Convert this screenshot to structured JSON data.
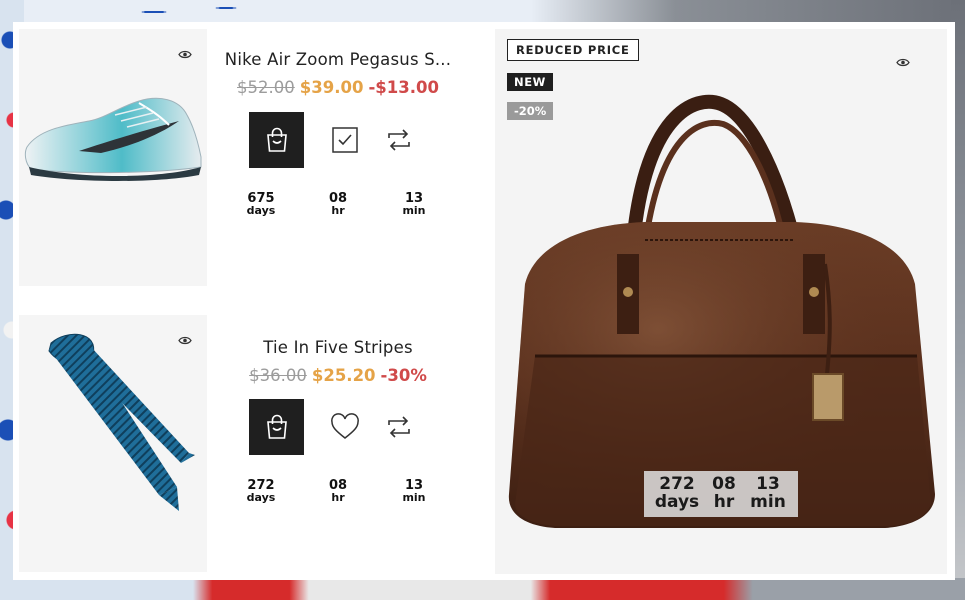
{
  "products": [
    {
      "title": "Nike Air Zoom Pegasus S...",
      "old_price": "$52.00",
      "new_price": "$39.00",
      "discount": "-$13.00",
      "actions": [
        "shopping-bag-icon",
        "checkbox-checked-icon",
        "compare-icon"
      ],
      "countdown": {
        "days": "675",
        "days_label": "days",
        "hr": "08",
        "hr_label": "hr",
        "min": "13",
        "min_label": "min"
      }
    },
    {
      "title": "Tie In Five Stripes",
      "old_price": "$36.00",
      "new_price": "$25.20",
      "discount": "-30%",
      "actions": [
        "shopping-bag-icon",
        "heart-icon",
        "compare-icon"
      ],
      "countdown": {
        "days": "272",
        "days_label": "days",
        "hr": "08",
        "hr_label": "hr",
        "min": "13",
        "min_label": "min"
      }
    }
  ],
  "featured": {
    "badge_reduced": "REDUCED PRICE",
    "badge_new": "NEW",
    "badge_percent": "-20%",
    "countdown": {
      "days": "272",
      "days_label": "days",
      "hr": "08",
      "hr_label": "hr",
      "min": "13",
      "min_label": "min"
    }
  },
  "colors": {
    "sale_price": "#e5a347",
    "discount": "#d04a4a",
    "old_price": "#9c9c9c",
    "button_dark": "#1f1f1f"
  }
}
